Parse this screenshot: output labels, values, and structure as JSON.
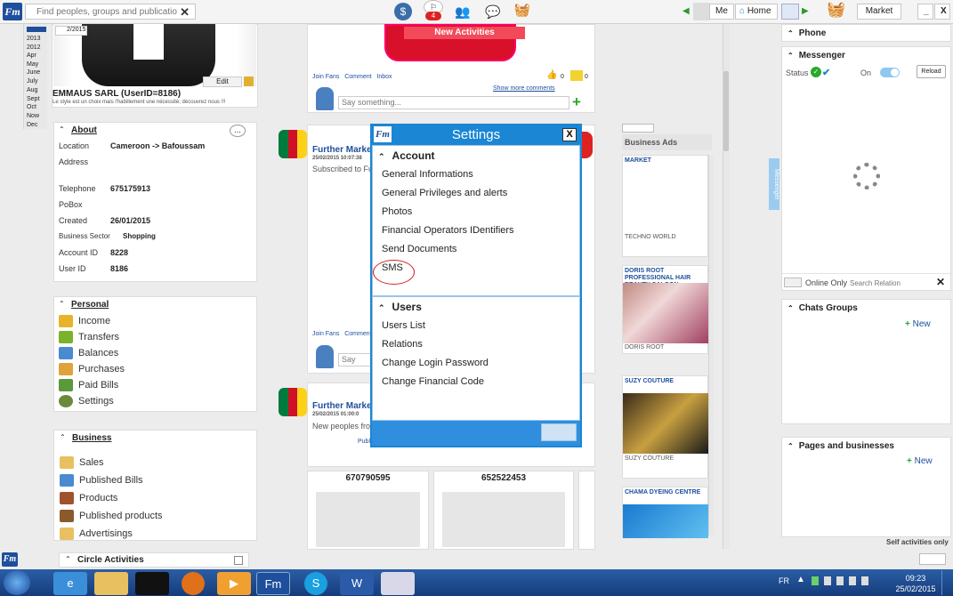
{
  "topbar": {
    "logo": "Fm",
    "search_placeholder": "Find peoples, groups and publications",
    "search_clear": "✕",
    "notif_count": "4",
    "me_label": "Me",
    "home_label": "Home",
    "market_label": "Market",
    "minimize": "_",
    "close": "X"
  },
  "profile": {
    "years": [
      "2013",
      "2012"
    ],
    "months": [
      "Apr",
      "May",
      "June",
      "July",
      "Aug",
      "Sept",
      "Oct",
      "Now",
      "Dec"
    ],
    "photo_date": "2/2015",
    "edit_label": "Edit",
    "name": "EMMAUS SARL (UserID=8186)",
    "tagline": "Le style est un choix mais l'habillement une nécessité; découvrez nous !!!"
  },
  "about": {
    "title": "About",
    "more": "...",
    "location_k": "Location",
    "location_v": "Cameroon -> Bafoussam",
    "address_k": "Address",
    "telephone_k": "Telephone",
    "telephone_v": "675175913",
    "pobox_k": "PoBox",
    "created_k": "Created",
    "created_v": "26/01/2015",
    "sector_k": "Business Sector",
    "sector_v": "Shopping",
    "account_k": "Account ID",
    "account_v": "8228",
    "userid_k": "User ID",
    "userid_v": "8186"
  },
  "personal": {
    "title": "Personal",
    "items": [
      "Income",
      "Transfers",
      "Balances",
      "Purchases",
      "Paid Bills",
      "Settings"
    ]
  },
  "business": {
    "title": "Business",
    "items": [
      "Sales",
      "Published Bills",
      "Products",
      "Published products",
      "Advertisings"
    ]
  },
  "circle": {
    "title": "Circle Activities"
  },
  "feed": {
    "banner": "New Activities",
    "join_fans": "Join Fans",
    "comment": "Comment",
    "inbox": "Inbox",
    "likes": "0",
    "dislikes": "0",
    "show_more": "Show more comments",
    "say_something": "Say something...",
    "post1_title": "Further Market",
    "post1_date": "25/02/2015 10:07:38",
    "post1_text": "Subscribed to Fu",
    "post2_title": "Further Market",
    "post2_date": "25/02/2015 01:00:0",
    "post2_text": "New peoples fro",
    "post2_sub": "Publ",
    "say_some": "Say som",
    "phone1": "670790595",
    "phone2": "652522453"
  },
  "modal": {
    "title": "Settings",
    "close": "X",
    "account_title": "Account",
    "account_items": [
      "General Informations",
      "General Privileges and alerts",
      "Photos",
      "Financial Operators IDentifiers",
      "Send Documents",
      "SMS"
    ],
    "users_title": "Users",
    "users_items": [
      "Users List",
      "Relations",
      "Change Login Password",
      "Change Financial Code"
    ]
  },
  "ads": {
    "title": "Business Ads",
    "ad1_top": "MARKET",
    "ad1_bottom": "TECHNO WORLD",
    "ad2_top": "DORIS ROOT PROFESSIONAL HAIR BEAUTY SALOON",
    "ad2_bottom": "DORIS ROOT",
    "ad3_top": "SUZY COUTURE",
    "ad3_bottom": "SUZY COUTURE",
    "ad4_top": "CHAMA DYEING CENTRE"
  },
  "right": {
    "phone": "Phone",
    "messenger": "Messenger",
    "status_label": "Status",
    "on_label": "On",
    "reload": "Reload",
    "messenger_tab": "Messenger",
    "online_only": "Online Only",
    "search_relation": "Search Relation",
    "chats_groups": "Chats Groups",
    "new1": "New",
    "pages_businesses": "Pages and businesses",
    "new2": "New",
    "self_activities": "Self activities only"
  },
  "taskbar": {
    "lang": "FR",
    "time": "09:23",
    "date": "25/02/2015"
  },
  "colors": {
    "accent": "#1a86d4",
    "brand": "#1d4f9c",
    "sms_circle": "#d42020"
  }
}
